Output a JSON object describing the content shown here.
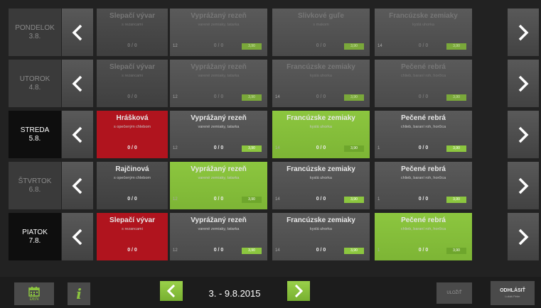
{
  "week": {
    "label": "3. - 9.8.2015"
  },
  "footer": {
    "day_label": "DEŇ",
    "info_label": "i",
    "save_label": "ULOŽIŤ",
    "logout_label": "ODHLÁSIŤ",
    "user": "Lukáš Peter"
  },
  "days": [
    {
      "name": "PONDELOK",
      "date": "3.8.",
      "state": "past",
      "meals": [
        {
          "name": "Slepačí vývar",
          "desc": "s rezancami",
          "count": "0 / 0",
          "num": "",
          "price": "",
          "style": "dim-plain"
        },
        {
          "name": "Vyprážaný rezeň",
          "desc": "varené zemiaky, tatarka",
          "count": "0 / 0",
          "num": "12",
          "price": "3,90",
          "style": "dim"
        },
        {
          "name": "Slivkové guľe",
          "desc": "s makom",
          "count": "0 / 0",
          "num": "",
          "price": "3,90",
          "style": "dim"
        },
        {
          "name": "Francúzske zemiaky",
          "desc": "kyslá uhorka",
          "count": "0 / 0",
          "num": "14",
          "price": "3,90",
          "style": "dim"
        }
      ]
    },
    {
      "name": "UTOROK",
      "date": "4.8.",
      "state": "past",
      "meals": [
        {
          "name": "Slepačí vývar",
          "desc": "s rezancami",
          "count": "0 / 0",
          "num": "",
          "price": "",
          "style": "dim-plain"
        },
        {
          "name": "Vyprážaný rezeň",
          "desc": "varené zemiaky, tatarka",
          "count": "0 / 0",
          "num": "12",
          "price": "3,90",
          "style": "dim"
        },
        {
          "name": "Francúzske zemiaky",
          "desc": "kyslá uhorka",
          "count": "0 / 0",
          "num": "14",
          "price": "3,90",
          "style": "dim"
        },
        {
          "name": "Pečené rebrá",
          "desc": "chlieb, baraní roh, horčica",
          "count": "0 / 0",
          "num": "",
          "price": "3,90",
          "style": "dim"
        }
      ]
    },
    {
      "name": "STREDA",
      "date": "5.8.",
      "state": "active",
      "meals": [
        {
          "name": "Hrášková",
          "desc": "s opečeným chlebom",
          "count": "0 / 0",
          "num": "",
          "price": "",
          "style": "red"
        },
        {
          "name": "Vyprážaný rezeň",
          "desc": "varené zemiaky, tatarka",
          "count": "0 / 0",
          "num": "12",
          "price": "3,90",
          "style": "normal"
        },
        {
          "name": "Francúzske zemiaky",
          "desc": "kyslá uhorka",
          "count": "0 / 0",
          "num": "14",
          "price": "3,90",
          "style": "green"
        },
        {
          "name": "Pečené rebrá",
          "desc": "chlieb, baraní roh, horčica",
          "count": "0 / 0",
          "num": "1",
          "price": "3,90",
          "style": "normal"
        }
      ]
    },
    {
      "name": "ŠTVRTOK",
      "date": "6.8.",
      "state": "past",
      "meals": [
        {
          "name": "Rajčinová",
          "desc": "s opečeným chlebom",
          "count": "0 / 0",
          "num": "",
          "price": "",
          "style": "plain"
        },
        {
          "name": "Vyprážaný rezeň",
          "desc": "varené zemiaky, tatarka",
          "count": "0 / 0",
          "num": "12",
          "price": "3,90",
          "style": "green"
        },
        {
          "name": "Francúzske zemiaky",
          "desc": "kyslá uhorka",
          "count": "0 / 0",
          "num": "14",
          "price": "3,90",
          "style": "normal"
        },
        {
          "name": "Pečené rebrá",
          "desc": "chlieb, baraní roh, horčica",
          "count": "0 / 0",
          "num": "1",
          "price": "3,90",
          "style": "normal"
        }
      ]
    },
    {
      "name": "PIATOK",
      "date": "7.8.",
      "state": "active",
      "meals": [
        {
          "name": "Slepačí vývar",
          "desc": "s rezancami",
          "count": "0 / 0",
          "num": "",
          "price": "",
          "style": "red"
        },
        {
          "name": "Vyprážaný rezeň",
          "desc": "varené zemiaky, tatarka",
          "count": "0 / 0",
          "num": "12",
          "price": "3,90",
          "style": "normal"
        },
        {
          "name": "Francúzske zemiaky",
          "desc": "kyslá uhorka",
          "count": "0 / 0",
          "num": "14",
          "price": "3,90",
          "style": "normal"
        },
        {
          "name": "Pečené rebrá",
          "desc": "chlieb, baraní roh, horčica",
          "count": "0 / 0",
          "num": "1",
          "price": "3,90",
          "style": "green"
        }
      ]
    }
  ]
}
